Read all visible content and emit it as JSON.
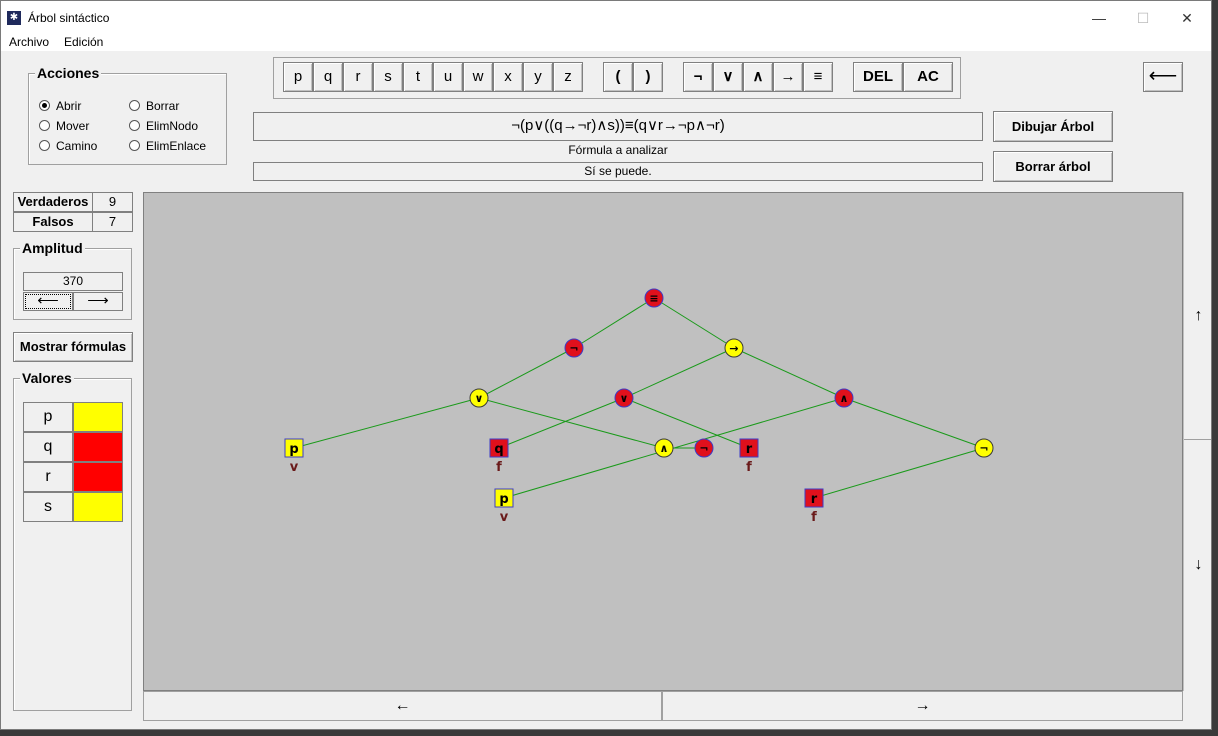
{
  "window": {
    "title": "Árbol sintáctico",
    "minimize": "—",
    "maximize": "☐",
    "close": "✕"
  },
  "menu": {
    "archivo": "Archivo",
    "edicion": "Edición"
  },
  "acciones": {
    "title": "Acciones",
    "options": [
      "Abrir",
      "Mover",
      "Camino",
      "Borrar",
      "ElimNodo",
      "ElimEnlace"
    ],
    "selected": "Abrir"
  },
  "palette": {
    "vars": [
      "p",
      "q",
      "r",
      "s",
      "t",
      "u",
      "w",
      "x",
      "y",
      "z"
    ],
    "parens": [
      "(",
      ")"
    ],
    "ops": [
      "¬",
      "∨",
      "∧",
      "→",
      "≡"
    ],
    "del": "DEL",
    "ac": "AC"
  },
  "back_button": "⟵",
  "formula": {
    "value": "¬(p∨((q→¬r)∧s))≡(q∨r→¬p∧¬r)",
    "caption": "Fórmula a analizar",
    "status": "Sí se puede."
  },
  "buttons": {
    "draw": "Dibujar Árbol",
    "clear": "Borrar árbol",
    "show_formulas": "Mostrar fórmulas"
  },
  "counts": {
    "true_label": "Verdaderos",
    "true_value": "9",
    "false_label": "Falsos",
    "false_value": "7"
  },
  "amplitud": {
    "title": "Amplitud",
    "value": "370",
    "left": "⟵",
    "right": "⟶"
  },
  "valores": {
    "title": "Valores",
    "items": [
      {
        "name": "p",
        "color": "#ffff00"
      },
      {
        "name": "q",
        "color": "#ff0000"
      },
      {
        "name": "r",
        "color": "#ff0000"
      },
      {
        "name": "s",
        "color": "#ffff00"
      }
    ]
  },
  "scroll": {
    "up": "↑",
    "down": "↓",
    "left": "←",
    "right": "→"
  },
  "colors": {
    "true": "#ffff00",
    "false": "#e0101c",
    "edge": "#1a9a1a",
    "border": "#3c3cc8"
  },
  "tree": {
    "nodes": [
      {
        "id": "eq",
        "kind": "op",
        "label": "≡",
        "value": "f"
      },
      {
        "id": "n1",
        "kind": "op",
        "label": "¬",
        "value": "f"
      },
      {
        "id": "imp",
        "kind": "op",
        "label": "→",
        "value": "v"
      },
      {
        "id": "or1",
        "kind": "op",
        "label": "∨",
        "value": "v"
      },
      {
        "id": "or2",
        "kind": "op",
        "label": "∨",
        "value": "f"
      },
      {
        "id": "and2",
        "kind": "op",
        "label": "∧",
        "value": "f"
      },
      {
        "id": "p1",
        "kind": "var",
        "label": "p",
        "value": "v",
        "caption": "v"
      },
      {
        "id": "q1",
        "kind": "var",
        "label": "q",
        "value": "f",
        "caption": "f"
      },
      {
        "id": "and1",
        "kind": "op",
        "label": "∧",
        "value": "v"
      },
      {
        "id": "n2",
        "kind": "op",
        "label": "¬",
        "value": "f"
      },
      {
        "id": "r1",
        "kind": "var",
        "label": "r",
        "value": "f",
        "caption": "f"
      },
      {
        "id": "n3",
        "kind": "op",
        "label": "¬",
        "value": "v"
      },
      {
        "id": "p2",
        "kind": "var",
        "label": "p",
        "value": "v",
        "caption": "v"
      },
      {
        "id": "r2",
        "kind": "var",
        "label": "r",
        "value": "f",
        "caption": "f"
      }
    ],
    "edges": [
      [
        "eq",
        "n1"
      ],
      [
        "eq",
        "imp"
      ],
      [
        "n1",
        "or1"
      ],
      [
        "imp",
        "or2"
      ],
      [
        "imp",
        "and2"
      ],
      [
        "or1",
        "p1"
      ],
      [
        "or1",
        "and1"
      ],
      [
        "or2",
        "q1"
      ],
      [
        "or2",
        "r1"
      ],
      [
        "and1",
        "n2"
      ],
      [
        "and2",
        "p2"
      ],
      [
        "and2",
        "n3"
      ],
      [
        "n3",
        "r2"
      ]
    ]
  }
}
